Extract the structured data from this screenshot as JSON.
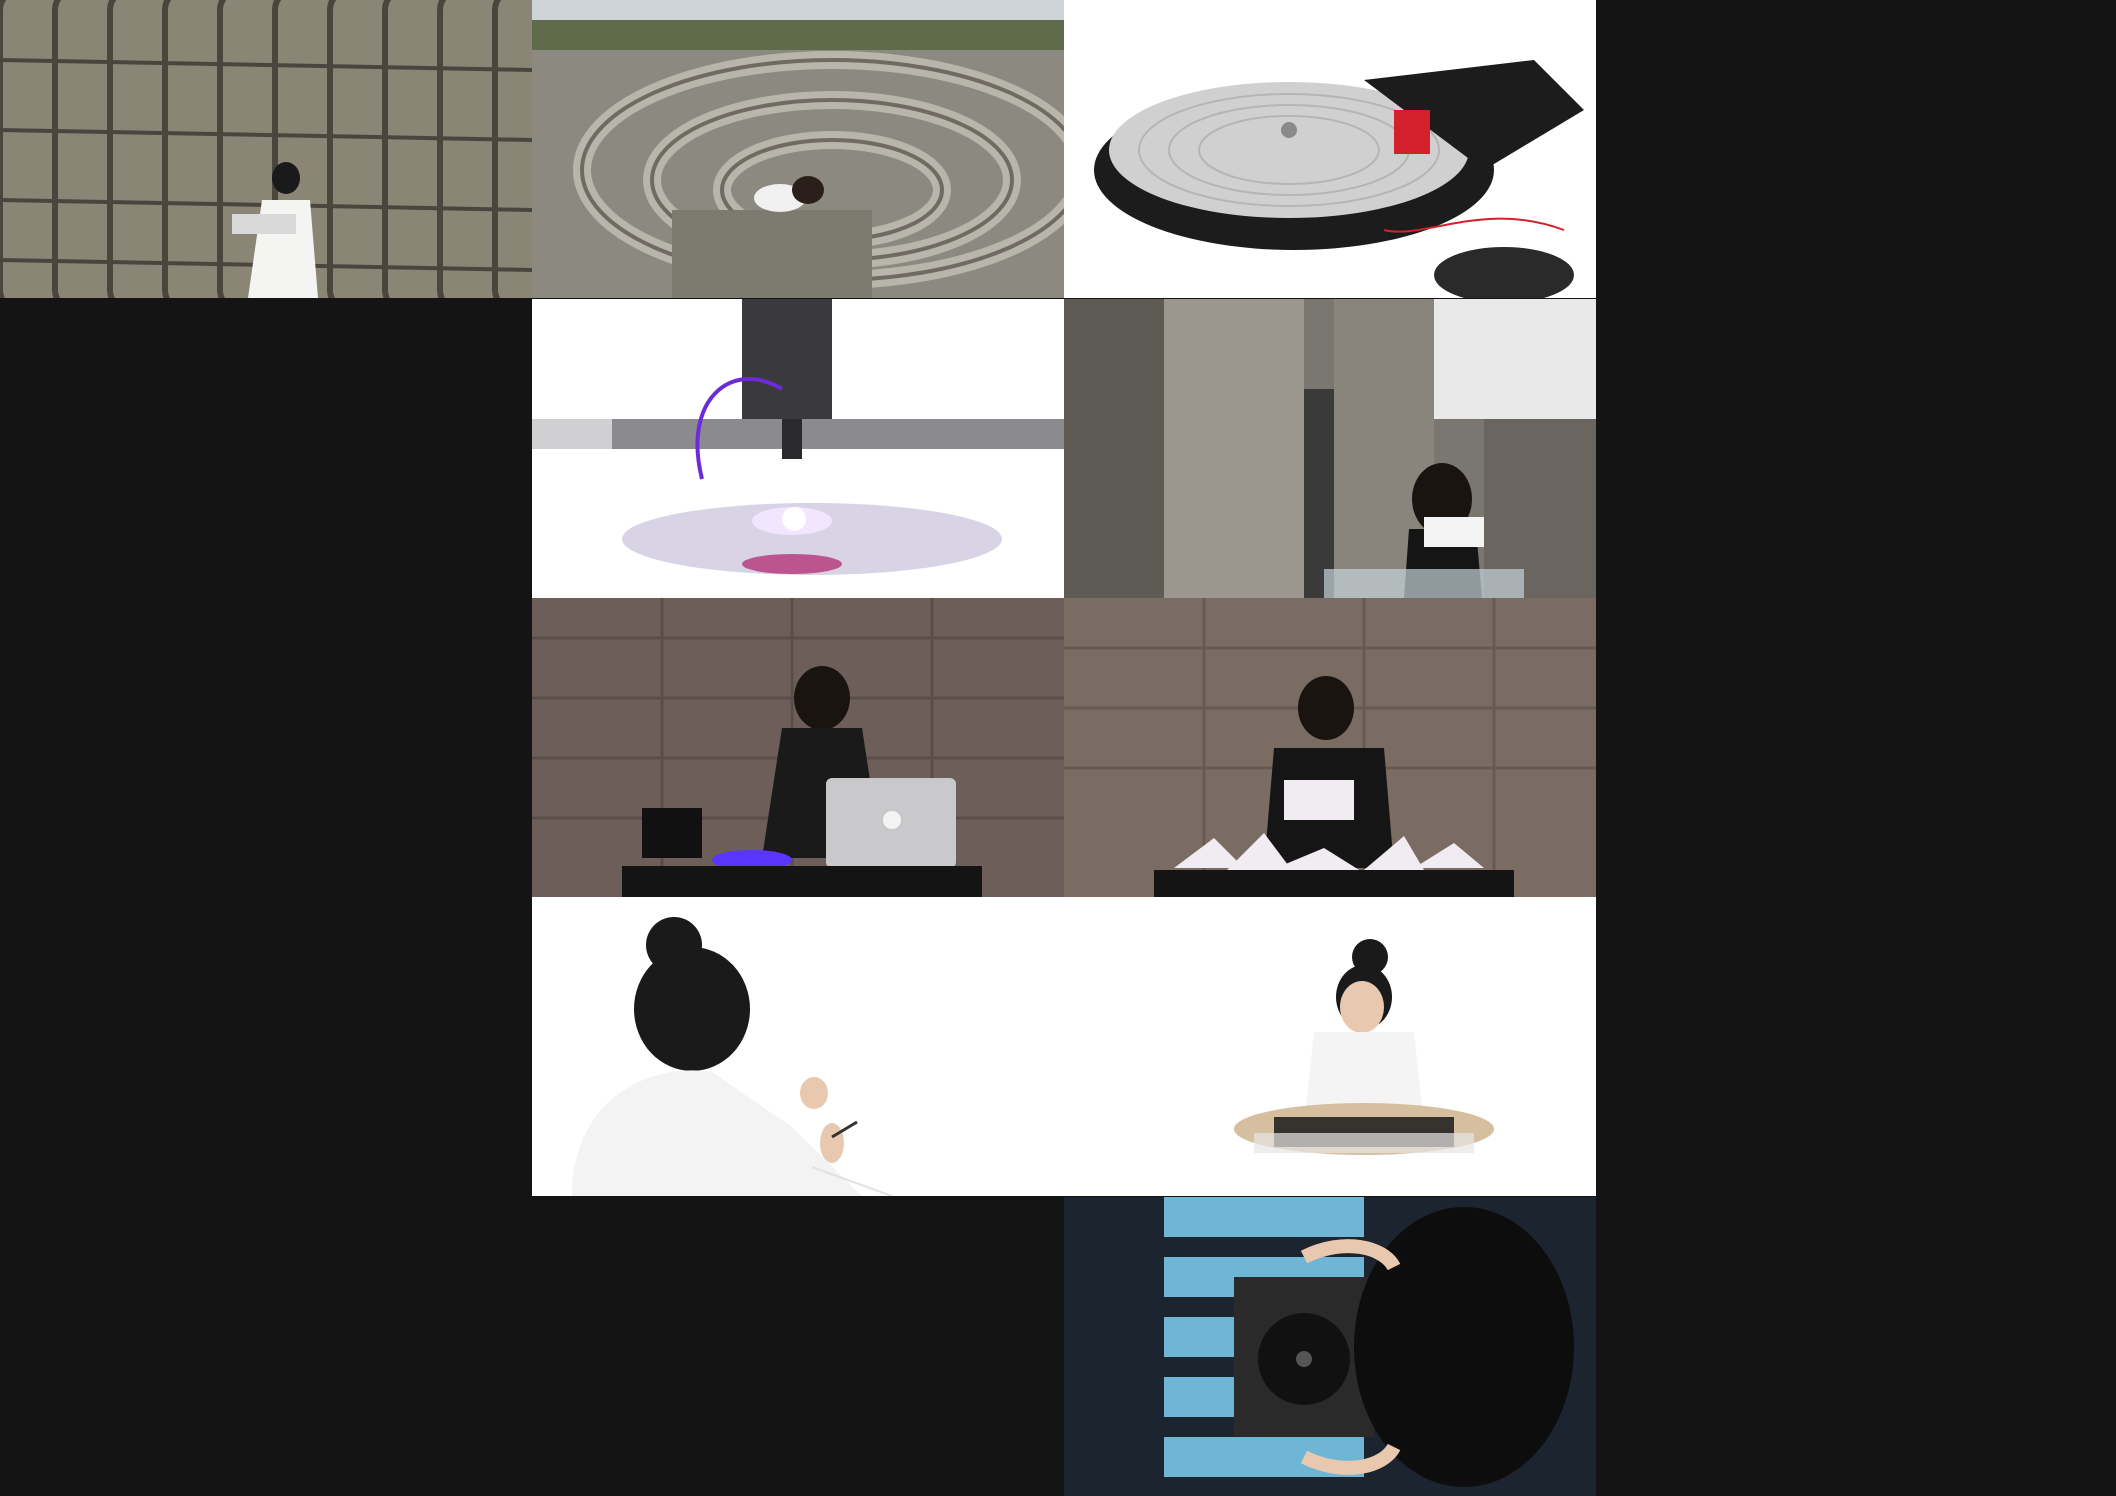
{
  "gallery": {
    "background_color": "#141414",
    "tiles": [
      {
        "subject": "basalt-columns-figure",
        "palette": [
          "#6e6a5e",
          "#8a8574",
          "#4a463d",
          "#f4f4f2"
        ]
      },
      {
        "subject": "stone-maze-figure",
        "palette": [
          "#8c8a80",
          "#b8b5aa",
          "#5f6b4a",
          "#cdd3d6"
        ]
      },
      {
        "subject": "turntable-device",
        "palette": [
          "#ffffff",
          "#1c1c1c",
          "#d0d0d0",
          "#d4202a"
        ]
      },
      {
        "subject": "laser-engraver-device",
        "palette": [
          "#ffffff",
          "#3a3a3e",
          "#6b2bd9",
          "#f2e6ff"
        ]
      },
      {
        "subject": "concrete-courtyard-figure",
        "palette": [
          "#7a7670",
          "#9c978e",
          "#3a3a3a",
          "#e9e9e9"
        ]
      },
      {
        "subject": "desk-laptop-figure",
        "palette": [
          "#6d5e5a",
          "#8a7a72",
          "#1a1a1a",
          "#5a35ff"
        ]
      },
      {
        "subject": "desk-paper-figure",
        "palette": [
          "#7a6c62",
          "#938476",
          "#151515",
          "#f0ecf2"
        ]
      },
      {
        "subject": "white-shirt-writing-figure",
        "palette": [
          "#ffffff",
          "#f3f3f3",
          "#1a1a1a",
          "#e8c9b0"
        ]
      },
      {
        "subject": "seated-device-figure",
        "palette": [
          "#ffffff",
          "#f4f4f4",
          "#d6bf9e",
          "#1a1a1a"
        ]
      },
      {
        "subject": "overhead-turntable-stairs",
        "palette": [
          "#1c2430",
          "#6fb6d6",
          "#2a2a2a",
          "#0d0d0d"
        ]
      }
    ]
  }
}
